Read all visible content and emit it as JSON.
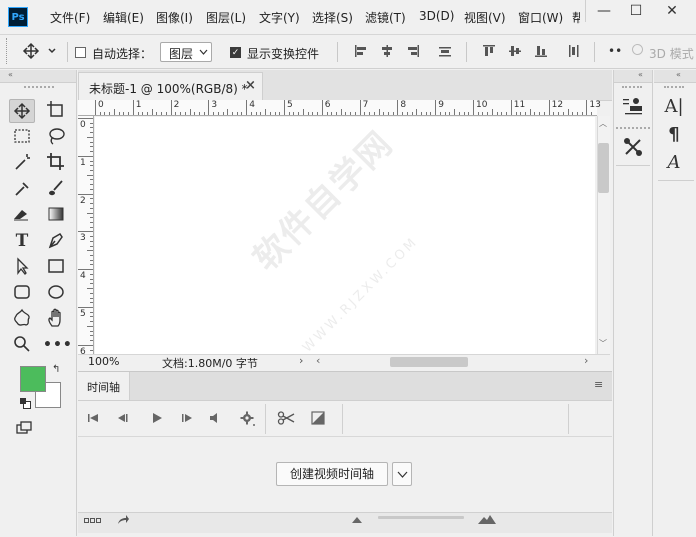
{
  "app": {
    "logo": "Ps"
  },
  "menu": [
    "文件(F)",
    "编辑(E)",
    "图像(I)",
    "图层(L)",
    "文字(Y)",
    "选择(S)",
    "滤镜(T)",
    "3D(D)",
    "视图(V)",
    "窗口(W)",
    "帮"
  ],
  "window_controls": {
    "minimize": "—",
    "maximize": "☐",
    "close": "✕"
  },
  "options": {
    "auto_select_label": "自动选择：",
    "auto_select_checked": false,
    "layer_select_value": "图层",
    "transform_controls_label": "显示变换控件",
    "transform_controls_checked": true,
    "mode_3d": "3D 模式"
  },
  "document": {
    "tab_label": "未标题-1 @ 100%(RGB/8) *",
    "tab_close": "×",
    "ruler_top": [
      "0",
      "1",
      "2",
      "3",
      "4",
      "5",
      "6",
      "7",
      "8",
      "9",
      "10",
      "11",
      "12",
      "13"
    ],
    "ruler_left": [
      "0",
      "1",
      "2",
      "3",
      "4",
      "5",
      "6"
    ],
    "zoom": "100%",
    "doc_info": "文档:1.80M/0 字节"
  },
  "timeline": {
    "tab_label": "时间轴",
    "create_button": "创建视频时间轴"
  },
  "watermark": {
    "text": "软件自学网",
    "url": "WWW.RJZXW.COM"
  },
  "colors": {
    "foreground": "#4cbc5c",
    "background": "#ffffff",
    "accent": "#31a8ff"
  },
  "icons": {
    "tools": [
      "move-icon",
      "artboard-icon",
      "marquee-icon",
      "lasso-icon",
      "magic-wand-icon",
      "crop-icon",
      "eyedropper-icon",
      "brush-icon",
      "eraser-icon",
      "gradient-icon",
      "type-icon",
      "pen-icon",
      "path-select-icon",
      "rectangle-icon",
      "rounded-rect-icon",
      "ellipse-icon",
      "custom-shape-icon",
      "hand-icon",
      "zoom-icon",
      "more-icon"
    ]
  }
}
